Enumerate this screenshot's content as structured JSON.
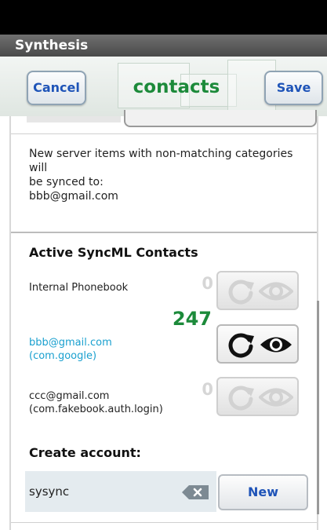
{
  "app": {
    "title": "Synthesis"
  },
  "header": {
    "cancel_label": "Cancel",
    "title": "contacts",
    "save_label": "Save"
  },
  "info": {
    "line1": "New server items with non-matching categories will",
    "line2": "be synced to:",
    "line3": "bbb@gmail.com"
  },
  "active_contacts": {
    "title": "Active SyncML Contacts",
    "accounts": [
      {
        "name_line1": "Internal Phonebook",
        "name_line2": "",
        "count": "0",
        "enabled": false
      },
      {
        "name_line1": "bbb@gmail.com",
        "name_line2": "(com.google)",
        "count": "247",
        "enabled": true
      },
      {
        "name_line1": "ccc@gmail.com",
        "name_line2": "(com.fakebook.auth.login)",
        "count": "0",
        "enabled": false
      }
    ]
  },
  "create_account": {
    "label": "Create account:",
    "input_value": "sysync",
    "new_label": "New"
  },
  "icons": {
    "sync": "sync-icon",
    "eye": "eye-icon",
    "clear": "clear-text-icon"
  },
  "colors": {
    "title_green": "#1c8a3a",
    "link_blue": "#1aa0cf",
    "button_blue": "#1f54b8"
  }
}
